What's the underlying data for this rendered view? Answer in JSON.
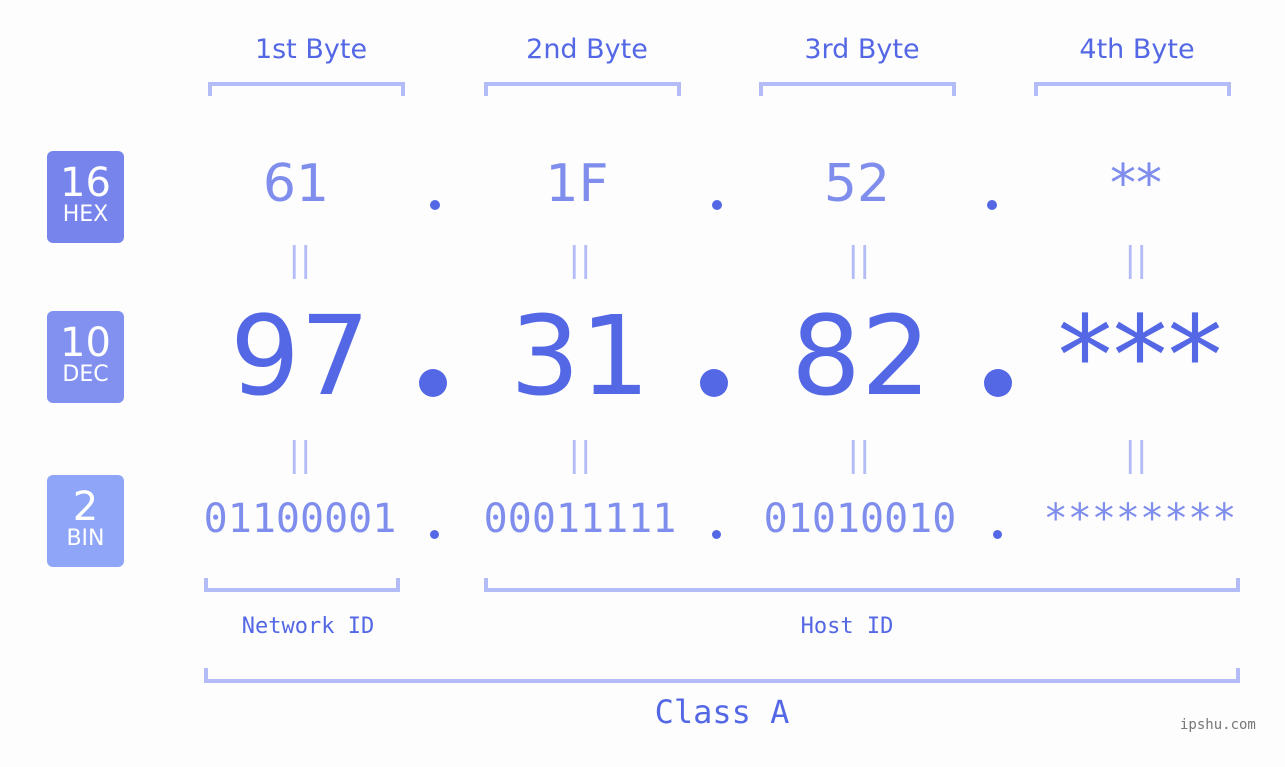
{
  "byte_headers": [
    "1st Byte",
    "2nd Byte",
    "3rd Byte",
    "4th Byte"
  ],
  "rows": {
    "hex": {
      "base": "16",
      "name": "HEX",
      "color": "#7784ec",
      "values": [
        "61",
        "1F",
        "52",
        "**"
      ]
    },
    "dec": {
      "base": "10",
      "name": "DEC",
      "color": "#8291f0",
      "values": [
        "97",
        "31",
        "82",
        "***"
      ]
    },
    "bin": {
      "base": "2",
      "name": "BIN",
      "color": "#8fa6f8",
      "values": [
        "01100001",
        "00011111",
        "01010010",
        "********"
      ]
    }
  },
  "equals_symbol": "||",
  "segments": {
    "network": "Network ID",
    "host": "Host ID"
  },
  "ip_class": "Class A",
  "watermark": "ipshu.com",
  "colors": {
    "primary": "#5468e6",
    "light": "#7f8ded",
    "bracket": "#b3bcf6",
    "background": "#fcfdfc"
  }
}
